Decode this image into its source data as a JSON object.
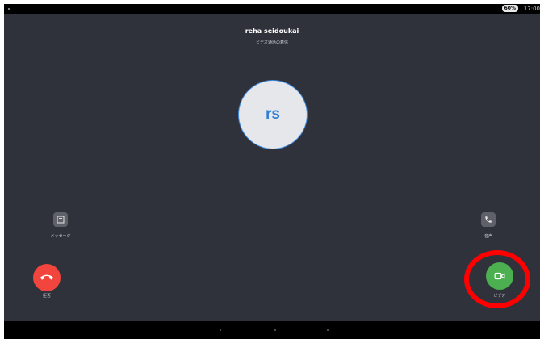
{
  "statusbar": {
    "battery": "60%",
    "time": "17:00"
  },
  "call": {
    "caller_name": "reha seidoukai",
    "status": "ビデオ通話の着信",
    "avatar_initials": "rs"
  },
  "actions": {
    "message_label": "メッセージ",
    "voice_label": "音声",
    "decline_label": "拒否",
    "video_label": "ビデオ"
  },
  "colors": {
    "background": "#30323b",
    "decline": "#f2453d",
    "video": "#4caf50",
    "accent": "#2e7fd6",
    "highlight": "#ff0000"
  },
  "icons": {
    "message": "message-icon",
    "voice": "phone-icon",
    "decline": "hang-up-icon",
    "video": "video-camera-icon"
  }
}
